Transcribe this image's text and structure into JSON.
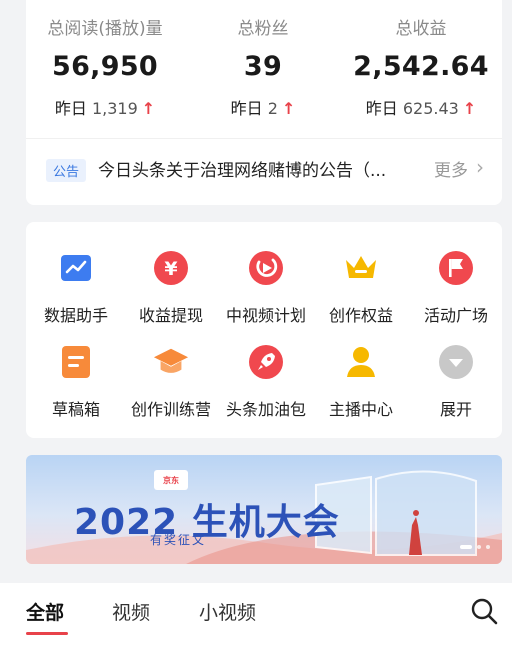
{
  "stats": [
    {
      "label": "总阅读(播放)量",
      "value": "56,950",
      "delta_prefix": "昨日",
      "delta_value": "1,319",
      "arrow": "↑"
    },
    {
      "label": "总粉丝",
      "value": "39",
      "delta_prefix": "昨日",
      "delta_value": "2",
      "arrow": "↑"
    },
    {
      "label": "总收益",
      "value": "2,542.64",
      "delta_prefix": "昨日",
      "delta_value": "625.43",
      "arrow": "↑"
    }
  ],
  "notice": {
    "badge": "公告",
    "text": "今日头条关于治理网络赌博的公告（...",
    "more": "更多"
  },
  "tools": [
    {
      "label": "数据助手",
      "icon": "chart-icon",
      "color": "#3d7cf0"
    },
    {
      "label": "收益提现",
      "icon": "yuan-icon",
      "color": "#f0484e"
    },
    {
      "label": "中视频计划",
      "icon": "play-icon",
      "color": "#f0484e"
    },
    {
      "label": "创作权益",
      "icon": "crown-icon",
      "color": "#f6b800"
    },
    {
      "label": "活动广场",
      "icon": "flag-icon",
      "color": "#f0484e"
    },
    {
      "label": "草稿箱",
      "icon": "draft-icon",
      "color": "#f78a3a"
    },
    {
      "label": "创作训练营",
      "icon": "graduation-cap-icon",
      "color": "#f78a3a"
    },
    {
      "label": "头条加油包",
      "icon": "rocket-icon",
      "color": "#f0484e"
    },
    {
      "label": "主播中心",
      "icon": "anchor-person-icon",
      "color": "#f6b800"
    },
    {
      "label": "展开",
      "icon": "chevron-down-icon",
      "color": "#c8c8c8"
    }
  ],
  "banner": {
    "logo": "京东",
    "title": "2022 生机大会",
    "subtitle": "有奖征文"
  },
  "tabs": [
    {
      "label": "全部",
      "active": true
    },
    {
      "label": "视频",
      "active": false
    },
    {
      "label": "小视频",
      "active": false
    }
  ],
  "colors": {
    "accent_red": "#e8424a",
    "notice_blue": "#3a78e0",
    "banner_blue": "#2c52b8"
  }
}
